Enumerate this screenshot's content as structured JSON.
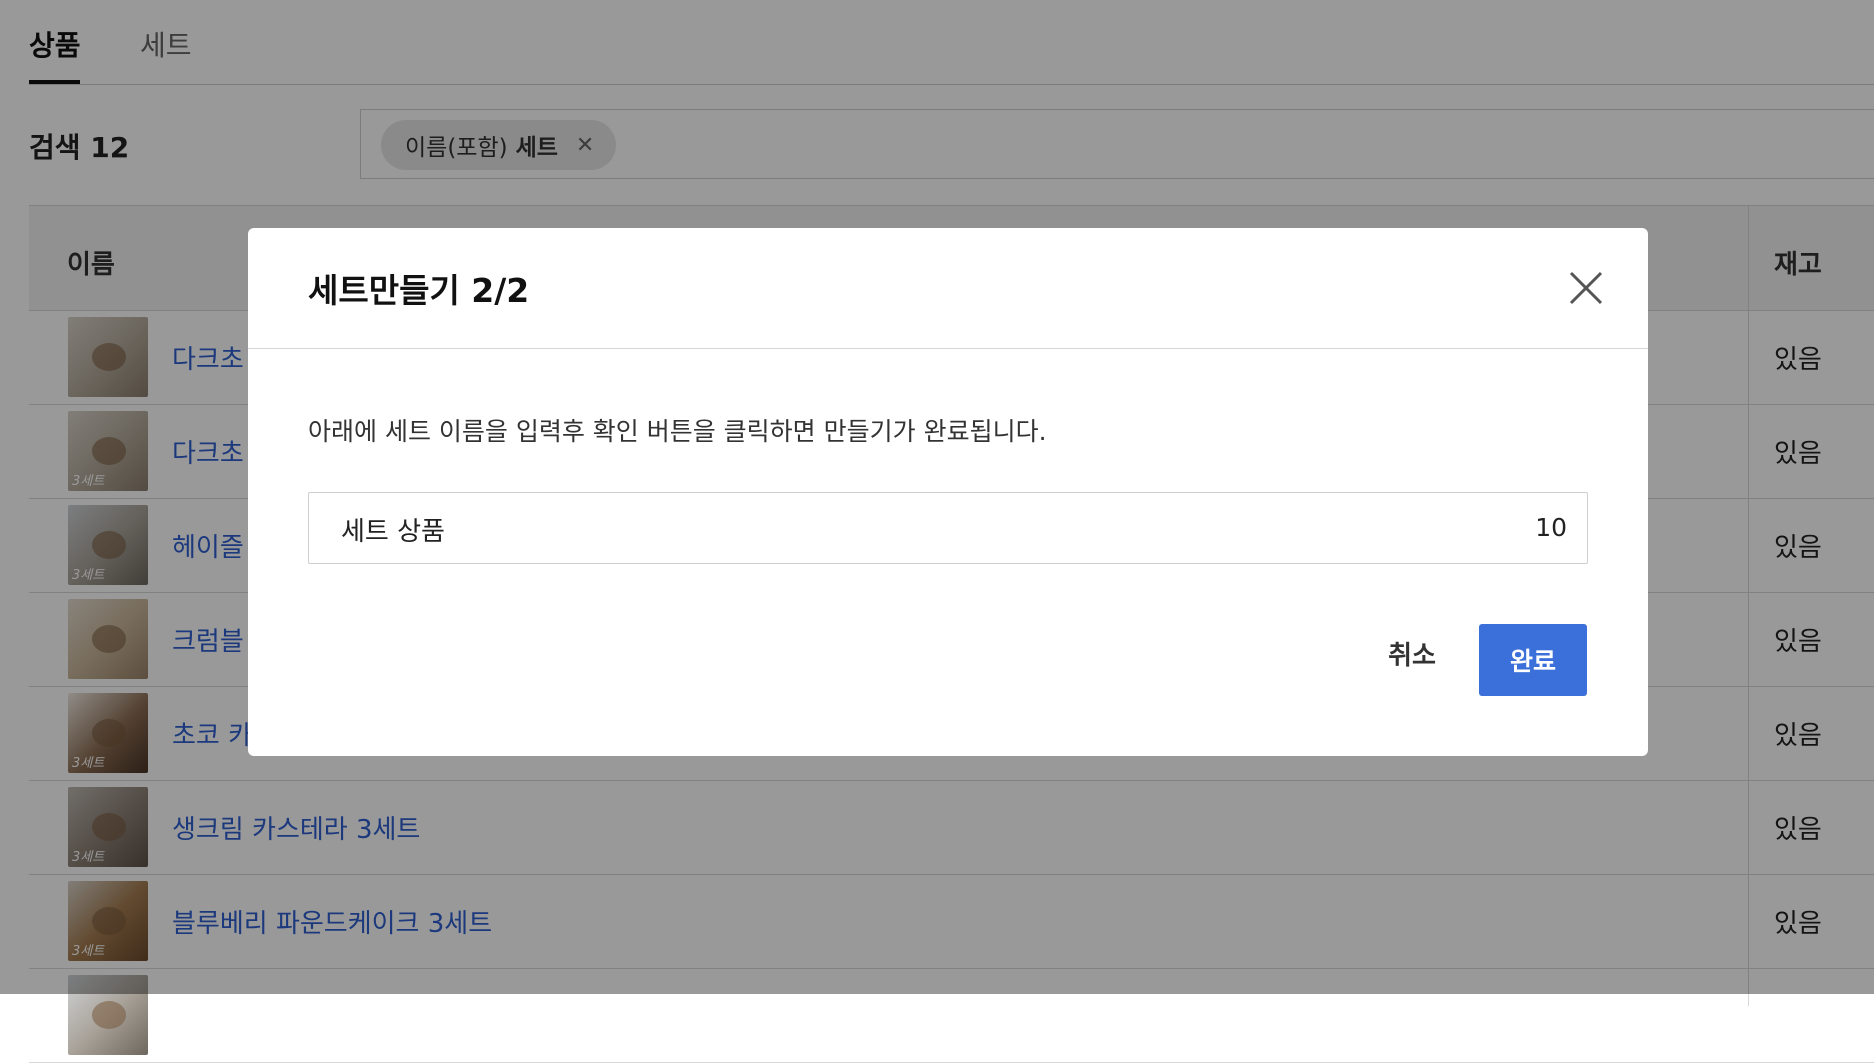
{
  "tabs": [
    {
      "label": "상품",
      "active": true
    },
    {
      "label": "세트",
      "active": false
    }
  ],
  "search": {
    "count_label": "검색 12",
    "chip_prefix": "이름(포함)",
    "chip_value": "세트",
    "link_partial": "세"
  },
  "table": {
    "headers": {
      "name": "이름",
      "stock": "재고"
    },
    "rows": [
      {
        "name": "다크초",
        "stock": "있음",
        "badge": ""
      },
      {
        "name": "다크초",
        "stock": "있음",
        "badge": "3세트"
      },
      {
        "name": "헤이즐",
        "stock": "있음",
        "badge": "3세트"
      },
      {
        "name": "크럼블",
        "stock": "있음",
        "badge": ""
      },
      {
        "name": "초코 카",
        "stock": "있음",
        "badge": "3세트"
      },
      {
        "name": "생크림 카스테라 3세트",
        "stock": "있음",
        "badge": "3세트"
      },
      {
        "name": "블루베리 파운드케이크 3세트",
        "stock": "있음",
        "badge": "3세트"
      },
      {
        "name": "",
        "stock": "",
        "badge": ""
      }
    ]
  },
  "modal": {
    "title": "세트만들기 2/2",
    "description": "아래에 세트 이름을 입력후 확인 버튼을 클릭하면 만들기가 완료됩니다.",
    "input_value": "세트 상품",
    "char_count": "10",
    "cancel_label": "취소",
    "confirm_label": "완료",
    "confirm_color": "#3b6fd9"
  },
  "icons": {
    "chip_remove": "close-icon",
    "modal_close": "close-icon"
  }
}
